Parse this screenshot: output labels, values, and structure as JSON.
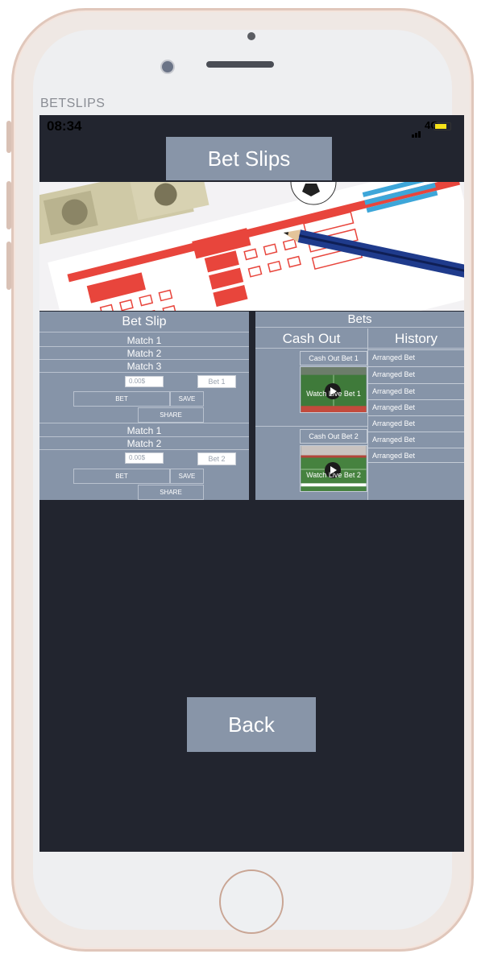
{
  "app_label": "BETSLIPS",
  "status_bar": {
    "time": "08:34",
    "network": "4G",
    "battery_color": "#f6e21a"
  },
  "header": {
    "title": "Bet Slips"
  },
  "banner": {
    "icon": "betting-slip-image"
  },
  "bet_slip": {
    "title": "Bet Slip",
    "group1": {
      "matches": [
        "Match 1",
        "Match 2",
        "Match 3"
      ],
      "amount_placeholder": "0.00$",
      "bet_placeholder": "Bet 1",
      "bet_label": "BET",
      "save_label": "SAVE",
      "share_label": "SHARE"
    },
    "group2": {
      "matches": [
        "Match 1",
        "Match 2"
      ],
      "amount_placeholder": "0.00$",
      "bet_placeholder": "Bet 2",
      "bet_label": "BET",
      "save_label": "SAVE",
      "share_label": "SHARE"
    }
  },
  "bets": {
    "title": "Bets",
    "cash_out_header": "Cash Out",
    "history_header": "History",
    "cash_out_items": [
      {
        "label": "Cash Out Bet 1",
        "video_label": "Watch Live Bet 1"
      },
      {
        "label": "Cash Out Bet 2",
        "video_label": "Watch Live Bet 2"
      }
    ],
    "history": [
      "Arranged Bet",
      "Arranged Bet",
      "Arranged Bet",
      "Arranged Bet",
      "Arranged Bet",
      "Arranged Bet",
      "Arranged Bet"
    ]
  },
  "footer": {
    "back_label": "Back"
  },
  "colors": {
    "screen_bg": "#22252f",
    "panel": "#8694a8",
    "button": "#8895a8"
  }
}
